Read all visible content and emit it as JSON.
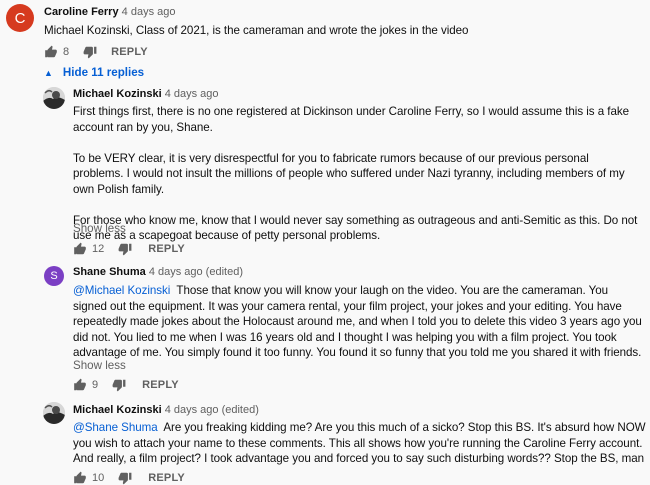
{
  "comment": {
    "author": "Caroline Ferry",
    "time": "4 days ago",
    "avatar_letter": "C",
    "avatar_color": "#d63a1f",
    "text": "Michael Kozinski, Class of 2021, is the cameraman and wrote the jokes in the video",
    "likes": "8",
    "reply_label": "REPLY",
    "replies_toggle": "Hide 11 replies"
  },
  "replies": [
    {
      "author": "Michael Kozinski",
      "time": "4 days ago",
      "paragraphs": [
        "First things first, there is no one registered at Dickinson under Caroline Ferry, so I would assume this is a fake account ran by you, Shane.",
        "To be VERY clear, it is very disrespectful for you to fabricate rumors because of our previous personal problems. I would not insult the millions of people who suffered under Nazi tyranny, including members of my own Polish family.",
        "For those who know me, know that I would never say something as outrageous and anti-Semitic as this. Do not use me as a scapegoat because of petty personal problems."
      ],
      "show_less": "Show less",
      "likes": "12",
      "reply_label": "REPLY"
    },
    {
      "author": "Shane Shuma",
      "time": "4 days ago (edited)",
      "avatar_letter": "S",
      "avatar_color": "#7b3fc4",
      "mention": "@Michael Kozinski",
      "text": "Those that know you will know your laugh on the video. You are the cameraman. You signed out the equipment. It was your camera rental, your film project, your jokes and your editing. You have repeatedly made jokes about the Holocaust around me, and when I told you to delete this video 3 years ago you did not. You lied to me when I was 16 years old and I thought I was helping you with a film project. You took advantage of me. You simply found it too funny. You found it so funny that you told me you shared it with friends.",
      "show_less": "Show less",
      "likes": "9",
      "reply_label": "REPLY"
    },
    {
      "author": "Michael Kozinski",
      "time": "4 days ago (edited)",
      "mention": "@Shane Shuma",
      "text": "Are you freaking kidding me? Are you this much of a sicko? Stop this BS. It's absurd how NOW you wish to attach your name to these comments. This all shows how you're running the Caroline Ferry account. And really, a film project? I took advantage you and forced you to say such disturbing words?? Stop the BS, man",
      "likes": "10",
      "reply_label": "REPLY"
    }
  ],
  "icons": {
    "like": "thumb-up-icon",
    "dislike": "thumb-down-icon",
    "collapse": "chevron-up-icon"
  }
}
